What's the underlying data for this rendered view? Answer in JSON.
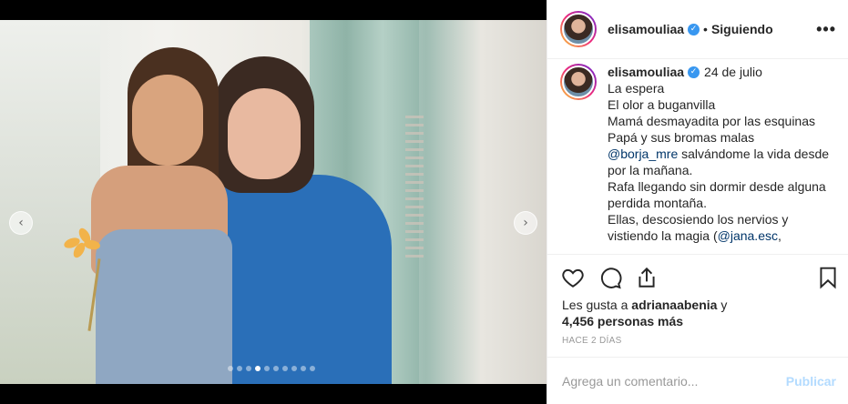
{
  "post": {
    "username": "elisamouliaa",
    "follow_sep": "•",
    "follow_status": "Siguiendo",
    "more": "•••"
  },
  "caption": {
    "date": "24 de julio",
    "lines": {
      "l1": "La espera",
      "l2": "El olor a buganvilla",
      "l3": "Mamá desmayadita por las esquinas",
      "l4": "Papá y sus bromas malas",
      "l5_mention": "@borja_mre",
      "l5_rest": " salvándome la vida desde",
      "l6": "por la mañana.",
      "l7": "Rafa llegando sin dormir desde alguna",
      "l8": "perdida montaña.",
      "l9": "Ellas, descosiendo los nervios y",
      "l10_start": "vistiendo la magia (",
      "l10_mention": "@jana.esc",
      "l10_end": ","
    }
  },
  "likes": {
    "prefix": "Les gusta a ",
    "user": "adrianaabenia",
    "mid": " y",
    "count": "4,456 personas más"
  },
  "time_ago": "HACE 2 DÍAS",
  "comment": {
    "placeholder": "Agrega un comentario...",
    "publish": "Publicar"
  },
  "carousel": {
    "total_slides": 10,
    "active_index": 4
  },
  "icons": [
    "chevron-left-icon",
    "chevron-right-icon",
    "heart-icon",
    "comment-icon",
    "share-icon",
    "bookmark-icon",
    "more-icon",
    "verified-icon"
  ],
  "colors": {
    "verified": "#3897f0",
    "publish_disabled": "#b3dbff",
    "mention": "#003569"
  }
}
